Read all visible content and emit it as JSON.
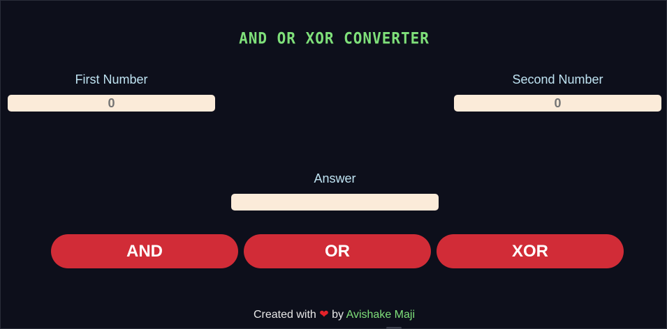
{
  "app": {
    "title": "AND OR XOR CONVERTER"
  },
  "inputs": {
    "first": {
      "label": "First Number",
      "placeholder": "0",
      "value": ""
    },
    "second": {
      "label": "Second Number",
      "placeholder": "0",
      "value": ""
    },
    "answer": {
      "label": "Answer",
      "placeholder": "",
      "value": ""
    }
  },
  "buttons": {
    "and_label": "AND",
    "or_label": "OR",
    "xor_label": "XOR"
  },
  "footer": {
    "prefix": "Created with",
    "heart_glyph": "❤",
    "middle": "by",
    "author": "Avishake Maji"
  },
  "colors": {
    "background": "#0d0f1b",
    "title": "#7fe07a",
    "label": "#bfe3f2",
    "input_bg": "#fbebd9",
    "button": "#d12c37",
    "heart": "#e5222a",
    "author_link": "#7fe07a"
  },
  "icons": {
    "heart": "heart-icon"
  }
}
